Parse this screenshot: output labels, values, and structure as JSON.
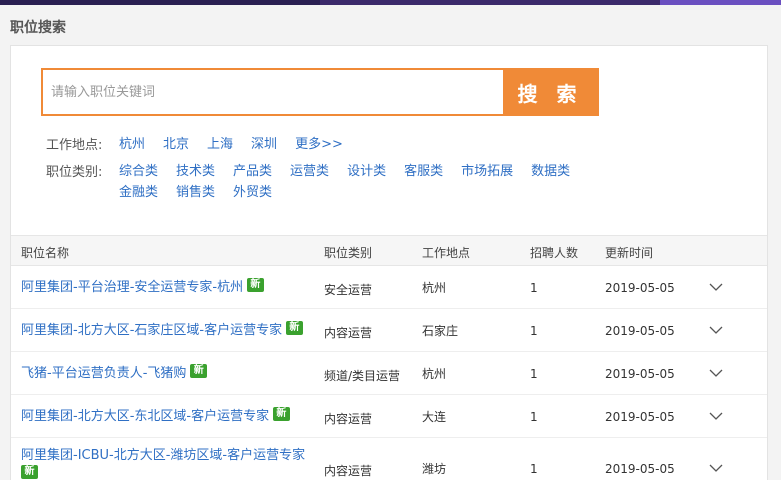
{
  "section_title": "职位搜索",
  "search": {
    "placeholder": "请输入职位关键词",
    "button_label": "搜 索"
  },
  "location_filter": {
    "label": "工作地点:",
    "options": [
      "杭州",
      "北京",
      "上海",
      "深圳",
      "更多>>"
    ]
  },
  "category_filter": {
    "label": "职位类别:",
    "options": [
      "综合类",
      "技术类",
      "产品类",
      "运营类",
      "设计类",
      "客服类",
      "市场拓展",
      "数据类",
      "金融类",
      "销售类",
      "外贸类"
    ]
  },
  "table": {
    "headers": {
      "name": "职位名称",
      "category": "职位类别",
      "location": "工作地点",
      "count": "招聘人数",
      "time": "更新时间"
    },
    "new_badge": "新",
    "rows": [
      {
        "title": "阿里集团-平台治理-安全运营专家-杭州",
        "category": "安全运营",
        "location": "杭州",
        "count": "1",
        "time": "2019-05-05"
      },
      {
        "title": "阿里集团-北方大区-石家庄区域-客户运营专家",
        "category": "内容运营",
        "location": "石家庄",
        "count": "1",
        "time": "2019-05-05"
      },
      {
        "title": "飞猪-平台运营负责人-飞猪购",
        "category": "频道/类目运营",
        "location": "杭州",
        "count": "1",
        "time": "2019-05-05"
      },
      {
        "title": "阿里集团-北方大区-东北区域-客户运营专家",
        "category": "内容运营",
        "location": "大连",
        "count": "1",
        "time": "2019-05-05"
      },
      {
        "title": "阿里集团-ICBU-北方大区-潍坊区域-客户运营专家",
        "category": "内容运营",
        "location": "潍坊",
        "count": "1",
        "time": "2019-05-05"
      }
    ]
  },
  "colors": {
    "accent": "#f08a37",
    "link": "#2f6fc4",
    "new_badge": "#3aa12e"
  }
}
